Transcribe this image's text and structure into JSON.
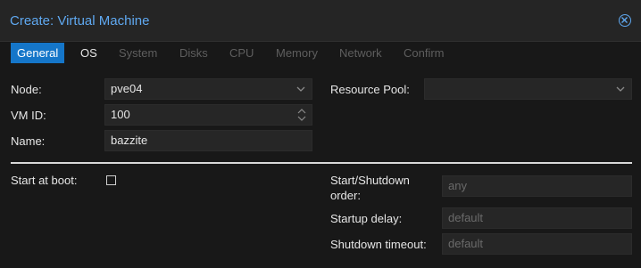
{
  "window": {
    "title": "Create: Virtual Machine"
  },
  "tabs": [
    {
      "label": "General"
    },
    {
      "label": "OS"
    },
    {
      "label": "System"
    },
    {
      "label": "Disks"
    },
    {
      "label": "CPU"
    },
    {
      "label": "Memory"
    },
    {
      "label": "Network"
    },
    {
      "label": "Confirm"
    }
  ],
  "form": {
    "node": {
      "label": "Node:",
      "value": "pve04"
    },
    "vmid": {
      "label": "VM ID:",
      "value": "100"
    },
    "name": {
      "label": "Name:",
      "value": "bazzite"
    },
    "resource_pool": {
      "label": "Resource Pool:",
      "value": ""
    },
    "start_at_boot": {
      "label": "Start at boot:",
      "checked": false
    },
    "start_shutdown_order": {
      "label_line1": "Start/Shutdown",
      "label_line2": "order:",
      "placeholder": "any"
    },
    "startup_delay": {
      "label": "Startup delay:",
      "placeholder": "default"
    },
    "shutdown_timeout": {
      "label": "Shutdown timeout:",
      "placeholder": "default"
    }
  },
  "colors": {
    "accent": "#1576c9",
    "title": "#5fa8f0",
    "background": "#181818"
  }
}
